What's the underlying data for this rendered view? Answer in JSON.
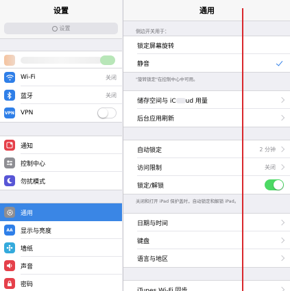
{
  "left": {
    "title": "设置",
    "search_placeholder": "设置",
    "group1": [
      {
        "label": "Wi-Fi",
        "value": "关闭",
        "color": "#2f7fe8",
        "icon": "wifi-icon"
      },
      {
        "label": "蓝牙",
        "value": "关闭",
        "color": "#2f7fe8",
        "icon": "bluetooth-icon"
      },
      {
        "label": "VPN",
        "color": "#2f7fe8",
        "icon": "vpn-icon"
      }
    ],
    "group2": [
      {
        "label": "通知",
        "color": "#e5404a",
        "icon": "notification-icon"
      },
      {
        "label": "控制中心",
        "color": "#8e8e93",
        "icon": "control-center-icon"
      },
      {
        "label": "勿扰模式",
        "color": "#5856d6",
        "icon": "moon-icon"
      }
    ],
    "group3": [
      {
        "label": "通用",
        "color": "#8e8e93",
        "icon": "gear-icon",
        "selected": true
      },
      {
        "label": "显示与亮度",
        "color": "#2f7fe8",
        "icon": "display-brightness-icon"
      },
      {
        "label": "墙纸",
        "color": "#34aadc",
        "icon": "wallpaper-icon"
      },
      {
        "label": "声音",
        "color": "#e5404a",
        "icon": "sound-icon"
      },
      {
        "label": "密码",
        "color": "#e5404a",
        "icon": "passcode-icon"
      }
    ]
  },
  "right": {
    "title": "通用",
    "side_switch_header": "侧边开关用于：",
    "side_switch_rows": [
      {
        "label": "锁定屏幕旋转"
      },
      {
        "label": "静音",
        "checked": true
      }
    ],
    "side_switch_footer": "\"旋转锁定\"在控制中心中可用。",
    "group_storage": [
      {
        "label_a": "储存空间与 iC",
        "label_b": "ud 用量"
      },
      {
        "label": "后台应用刷新"
      }
    ],
    "group_lock": [
      {
        "label": "自动锁定",
        "value": "2 分钟"
      },
      {
        "label": "访问限制",
        "value": "关闭"
      },
      {
        "label": "锁定/解锁",
        "toggle": "on"
      }
    ],
    "lock_footer": "关闭和打开 iPad 保护盖时，自动锁定和解锁 iPad。",
    "group_date": [
      {
        "label": "日期与时间"
      },
      {
        "label": "键盘"
      },
      {
        "label": "语言与地区"
      }
    ],
    "itunes_row": {
      "label": "iTunes Wi-Fi 同步"
    }
  },
  "colors": {
    "selection": "#3a86e5",
    "annotation_line": "#d9262b",
    "toggle_on": "#4cd964"
  }
}
